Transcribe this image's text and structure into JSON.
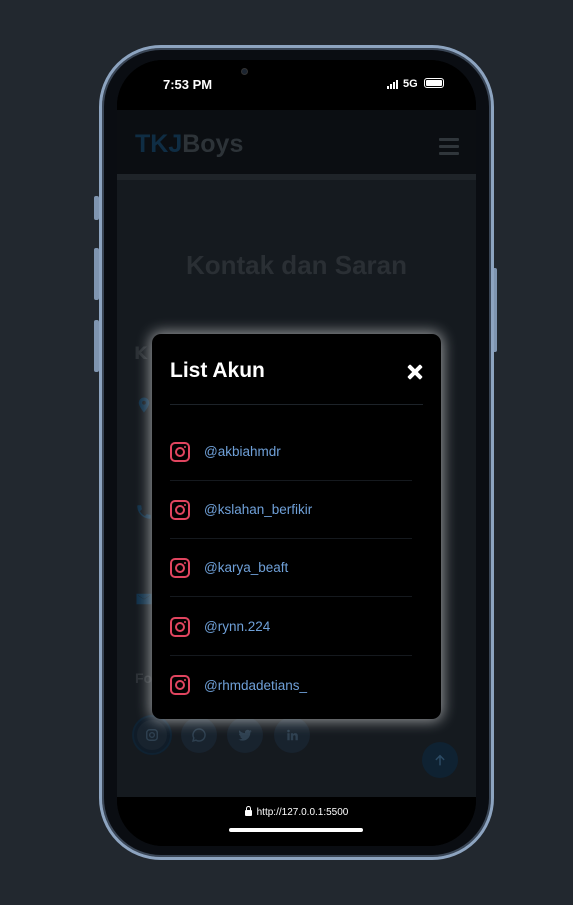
{
  "status_bar": {
    "time": "7:53 PM",
    "network": "5G"
  },
  "site": {
    "logo_part1": "TKJ",
    "logo_part2": "Boys",
    "section_title": "Kontak dan Saran",
    "side_heading_partial": "K",
    "follow_label": "Follow Us",
    "social_icons": [
      "instagram-icon",
      "whatsapp-icon",
      "twitter-icon",
      "linkedin-icon"
    ]
  },
  "modal": {
    "title": "List Akun",
    "accounts": [
      {
        "handle": "@akbiahmdr",
        "icon": "instagram-icon"
      },
      {
        "handle": "@kslahan_berfikir",
        "icon": "instagram-icon"
      },
      {
        "handle": "@karya_beaft",
        "icon": "instagram-icon"
      },
      {
        "handle": "@rynn.224",
        "icon": "instagram-icon"
      },
      {
        "handle": "@rhmdadetians_",
        "icon": "instagram-icon"
      }
    ]
  },
  "browser": {
    "url": "http://127.0.0.1:5500"
  },
  "colors": {
    "accent_handle": "#6fa0d8",
    "instagram": "#e0455f",
    "background": "#22282f"
  }
}
